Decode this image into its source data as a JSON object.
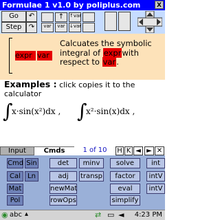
{
  "window": {
    "title": "Formulae 1 v1.0 by poliplus.com",
    "close_label": "X"
  },
  "toolbar": {
    "go_label": "Go",
    "step_label": "Step",
    "arrow_up_label": "↑",
    "arrow_up_var_label": "↑var",
    "arrow_down_var_label": "↓var",
    "var_label": "var",
    "var_down_label": "var",
    "undo_label": "↶",
    "redo_label": "↷"
  },
  "help": {
    "box_left": "expr",
    "box_right": "var",
    "text_pre": "Calcuates the symbolic integral of ",
    "text_expr": "expr",
    "text_mid": "with respect to ",
    "text_var": "var",
    "text_post": "."
  },
  "examples": {
    "heading": "Examples :",
    "note": "click copies it to the calculator",
    "example1": "x·sin(x²)dx ,",
    "example2": "x²·sin(x)dx ,"
  },
  "tabs": {
    "input": "Input",
    "cmds": "Cmds",
    "page": "1 of 10",
    "prev": "◄",
    "next": "►",
    "h": "H",
    "k": "K",
    "first": "◄",
    "last": "►"
  },
  "keypad": {
    "left": [
      [
        "Cmd",
        "Sin"
      ],
      [
        "Cal",
        "Ln"
      ],
      [
        "Mat",
        ""
      ],
      [
        "Pol",
        ""
      ]
    ],
    "col1": [
      "det",
      "adj",
      "newMat",
      "rowOps"
    ],
    "col2": [
      "minv",
      "transp",
      "",
      ""
    ],
    "col3": [
      "solve",
      "factor",
      "eval",
      "simplify"
    ],
    "col4": [
      "int",
      "intV",
      "intV",
      ""
    ]
  },
  "taskbar": {
    "abc": "abc",
    "time": "4:23 PM"
  }
}
